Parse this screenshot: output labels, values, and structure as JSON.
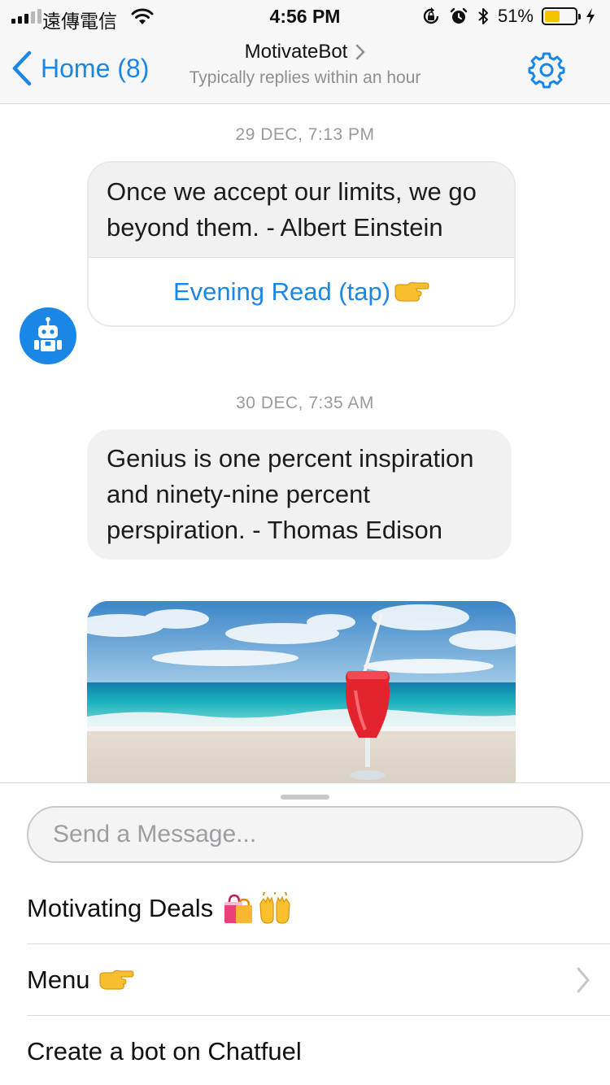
{
  "status_bar": {
    "carrier": "遠傳電信",
    "time": "4:56 PM",
    "battery_percent": "51%",
    "battery_level": 0.51
  },
  "header": {
    "back_label": "Home (8)",
    "title": "MotivateBot",
    "subtitle": "Typically replies within an hour",
    "settings_icon": "gear-icon",
    "accent_color": "#1a87e7"
  },
  "messages": [
    {
      "timestamp": "29 DEC, 7:13 PM",
      "text": "Once we accept our limits, we go beyond them. - Albert Einstein",
      "button_label": "Evening Read (tap)"
    },
    {
      "timestamp": "30 DEC, 7:35 AM",
      "text": "Genius is one percent inspiration and ninety-nine percent perspiration. - Thomas Edison",
      "image": "beach-cocktail-photo"
    }
  ],
  "composer": {
    "placeholder": "Send a Message...",
    "menu": [
      {
        "label": "Motivating Deals"
      },
      {
        "label": "Menu"
      },
      {
        "label": "Create a bot on Chatfuel"
      }
    ]
  }
}
